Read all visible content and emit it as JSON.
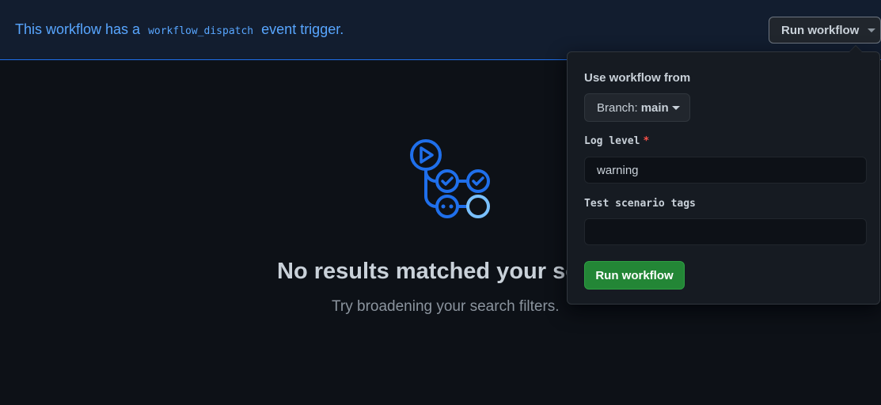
{
  "banner": {
    "text_before": "This workflow has a",
    "code": "workflow_dispatch",
    "text_after": "event trigger.",
    "run_button_label": "Run workflow"
  },
  "empty_state": {
    "icon": "workflow-graph-icon",
    "title": "No results matched your search.",
    "subtitle": "Try broadening your search filters."
  },
  "dropdown": {
    "heading": "Use workflow from",
    "branch_prefix": "Branch:",
    "branch_name": "main",
    "fields": [
      {
        "label": "Log level",
        "required": "*",
        "value": "warning"
      },
      {
        "label": "Test scenario tags",
        "value": ""
      }
    ],
    "submit_label": "Run workflow"
  },
  "colors": {
    "background": "#0d1117",
    "banner_bg": "#121d2f",
    "accent": "#58a6ff",
    "success": "#238636",
    "danger": "#f85149"
  }
}
